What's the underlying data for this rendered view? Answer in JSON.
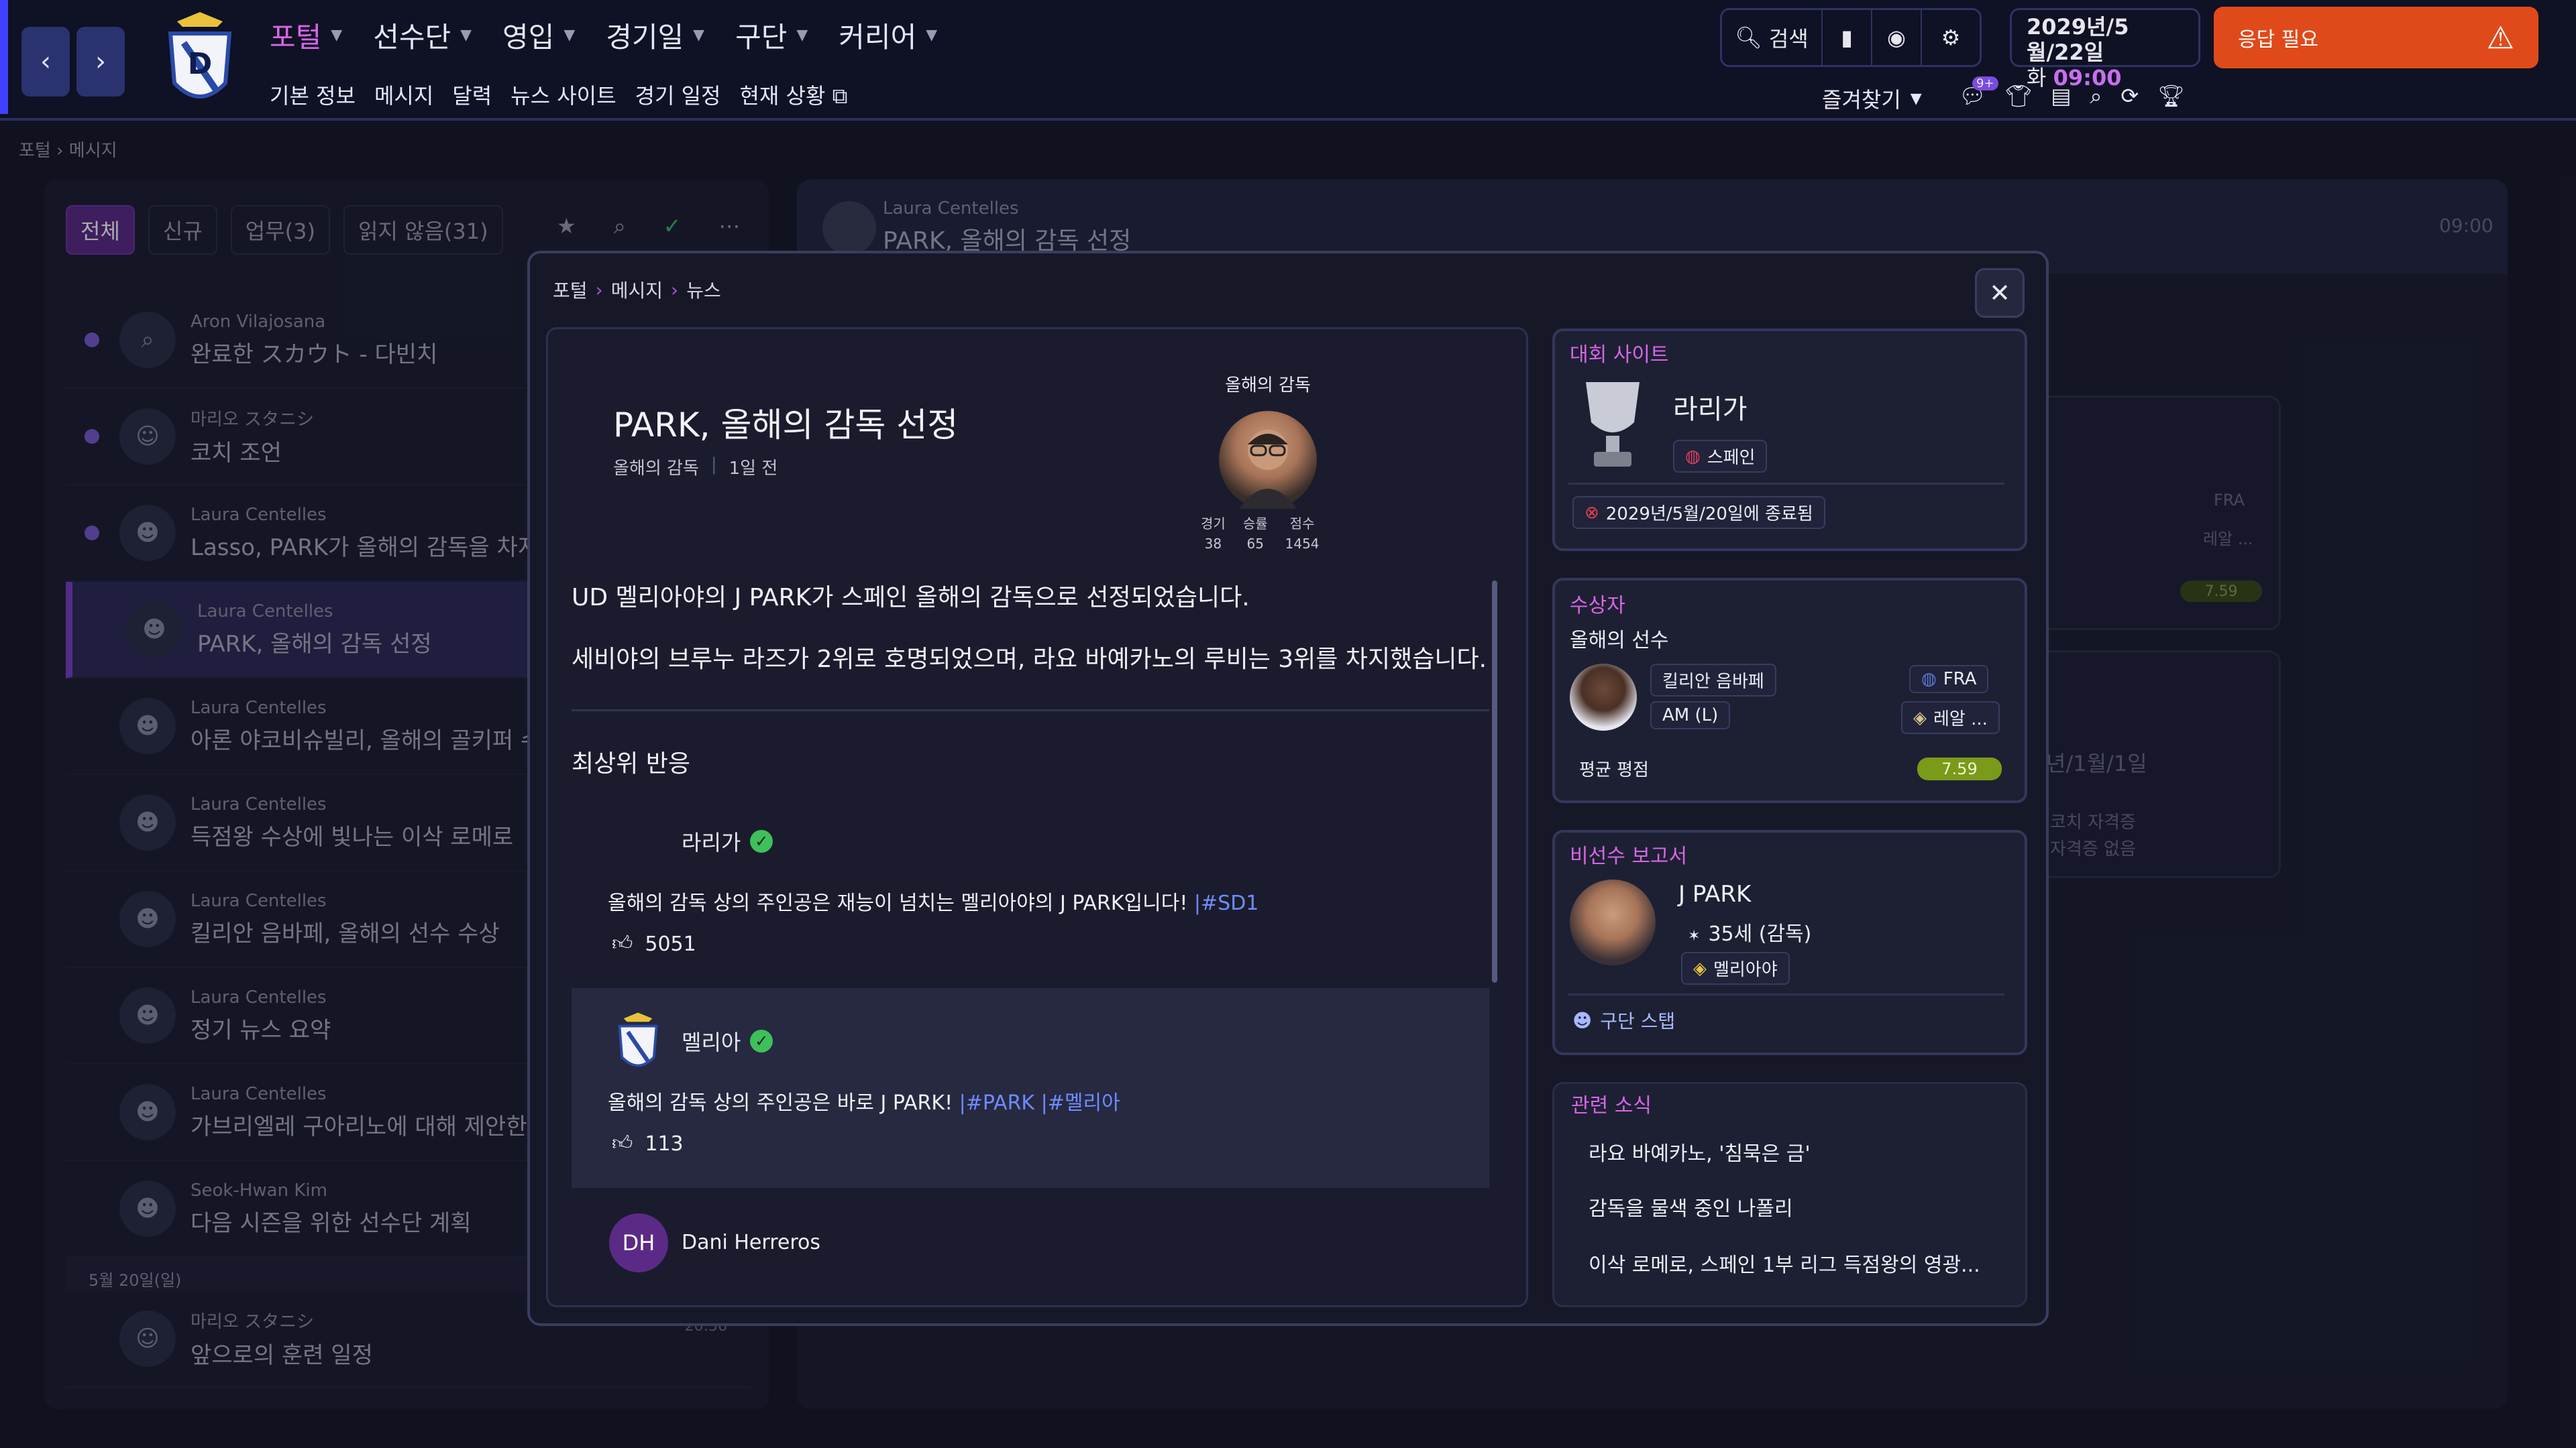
{
  "topbar": {
    "back": "‹",
    "forward": "›",
    "main_nav": [
      {
        "label": "포털",
        "active": true
      },
      {
        "label": "선수단",
        "active": false
      },
      {
        "label": "영입",
        "active": false
      },
      {
        "label": "경기일",
        "active": false
      },
      {
        "label": "구단",
        "active": false
      },
      {
        "label": "커리어",
        "active": false
      }
    ],
    "sub_nav": [
      "기본 정보",
      "메시지",
      "달력",
      "뉴스 사이트",
      "경기 일정",
      "현재 상황"
    ],
    "search_label": "검색",
    "date": "2029년/5월/22일",
    "weekday": "화",
    "time": "09:00",
    "alert_label": "응답 필요",
    "favorites_label": "즐겨찾기",
    "notif_badge": "9+"
  },
  "breadcrumb": {
    "root": "포털",
    "current": "메시지"
  },
  "inbox": {
    "filters": [
      "전체",
      "신규",
      "업무(3)",
      "읽지 않음(31)"
    ],
    "messages": [
      {
        "sender": "Aron Vilajosana",
        "subject": "완료한 スカウト - 다빈치",
        "unread": true,
        "icon": "search-icon"
      },
      {
        "sender": "마리오 スタニシ",
        "subject": "코치 조언",
        "unread": true,
        "icon": "group-icon"
      },
      {
        "sender": "Laura Centelles",
        "subject": "Lasso, PARK가 올해의 감독을 차지해 기쁘",
        "unread": true,
        "icon": "people-icon"
      },
      {
        "sender": "Laura Centelles",
        "subject": "PARK, 올해의 감독 선정",
        "unread": false,
        "icon": "people-icon",
        "selected": true
      },
      {
        "sender": "Laura Centelles",
        "subject": "아론 야코비슈빌리, 올해의 골키퍼 수상",
        "unread": false,
        "icon": "people-icon"
      },
      {
        "sender": "Laura Centelles",
        "subject": "득점왕 수상에 빛나는 이삭 로메로",
        "unread": false,
        "icon": "people-icon"
      },
      {
        "sender": "Laura Centelles",
        "subject": "킬리안 음바페, 올해의 선수 수상",
        "unread": false,
        "icon": "people-icon"
      },
      {
        "sender": "Laura Centelles",
        "subject": "정기 뉴스 요약",
        "unread": false,
        "icon": "people-icon"
      },
      {
        "sender": "Laura Centelles",
        "subject": "가브리엘레 구아리노에 대해 제안한 페예",
        "unread": false,
        "icon": "people-icon"
      },
      {
        "sender": "Seok-Hwan Kim",
        "subject": "다음 시즌을 위한 선수단 계획",
        "unread": false,
        "icon": "people-icon"
      }
    ],
    "day_separator": "5월 20일(일)",
    "last_message": {
      "sender": "마리오 スタニシ",
      "subject": "앞으로의 훈련 일정",
      "time": "20:56"
    }
  },
  "reading_header": {
    "sender": "Laura Centelles",
    "subject": "PARK, 올해의 감독 선정",
    "time": "09:00"
  },
  "background_cards": {
    "fra": "FRA",
    "real": "레알 ...",
    "rating": "7.59",
    "date_frag": "년/1월/1일",
    "coach_line1": "코치 자격증",
    "coach_line2": "자격증 없음"
  },
  "modal": {
    "breadcrumb": [
      "포털",
      "메시지",
      "뉴스"
    ],
    "article": {
      "title": "PARK, 올해의 감독 선정",
      "category": "올해의 감독",
      "age": "1일 전",
      "award_label": "올해의 감독",
      "stats": [
        {
          "label": "경기",
          "value": "38"
        },
        {
          "label": "승률",
          "value": "65"
        },
        {
          "label": "점수",
          "value": "1454"
        }
      ],
      "body": [
        "UD 멜리아야의 J PARK가 스페인 올해의 감독으로 선정되었습니다.",
        "세비야의 브루누 라즈가 2위로 호명되었으며, 라요 바예카노의 루비는 3위를 차지했습니다."
      ],
      "reactions_title": "최상위 반응",
      "posts": [
        {
          "author": "라리가",
          "text": "올해의 감독 상의 주인공은 재능이 넘치는 멜리아야의 J PARK입니다! ",
          "tags": "|#SD1",
          "likes": "5051"
        },
        {
          "author": "멜리아",
          "text": "올해의 감독 상의 주인공은 바로 J PARK! ",
          "tags": "|#PARK |#멜리아",
          "likes": "113"
        }
      ],
      "commenter_initials": "DH",
      "commenter": "Dani Herreros"
    },
    "competition": {
      "title": "대회 사이트",
      "name": "라리가",
      "country": "스페인",
      "ended": "2029년/5월/20일에 종료됨"
    },
    "winner": {
      "title": "수상자",
      "award": "올해의 선수",
      "player": "킬리안 음바페",
      "position": "AM (L)",
      "nation": "FRA",
      "club": "레알 ...",
      "avg_label": "평균 평점",
      "avg": "7.59"
    },
    "nonplayer": {
      "title": "비선수 보고서",
      "name": "J PARK",
      "age_role": "35세 (감독)",
      "club": "멜리아야",
      "staff_link": "구단 스탭"
    },
    "related": {
      "title": "관련 소식",
      "items": [
        "라요 바예카노, '침묵은 금'",
        "감독을 물색 중인 나폴리",
        "이삭 로메로, 스페인 1부 리그 득점왕의 영광..."
      ]
    }
  },
  "colors": {
    "accent": "#d766e6",
    "alert": "#e04a1a",
    "verified": "#3ec05a",
    "rating": "#7a9a1a"
  }
}
